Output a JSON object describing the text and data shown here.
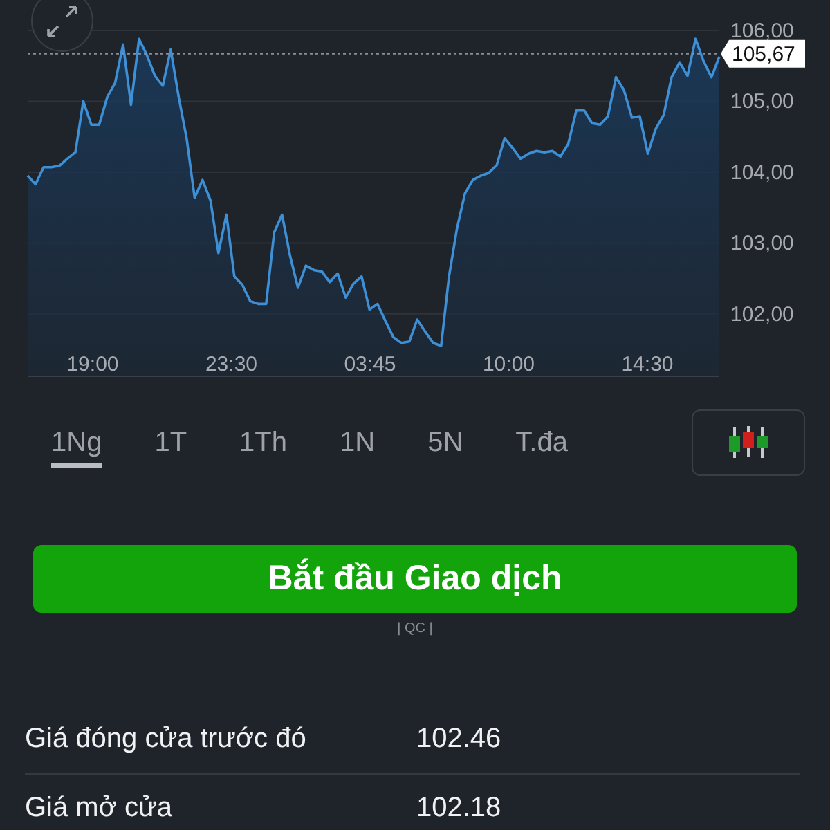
{
  "chart": {
    "time_labels": [
      "19:00",
      "23:30",
      "03:45",
      "10:00",
      "14:30"
    ],
    "chart_data": {
      "type": "area",
      "grid": true,
      "ylim": [
        101.12,
        106
      ],
      "yticks": [
        {
          "value": 102,
          "label": "102,00"
        },
        {
          "value": 103,
          "label": "103,00"
        },
        {
          "value": 104,
          "label": "104,00"
        },
        {
          "value": 105,
          "label": "105,00"
        },
        {
          "value": 106,
          "label": "106,00"
        }
      ],
      "series": [
        {
          "color": "#3d8fd6",
          "values": [
            103.95,
            103.83,
            104.07,
            104.07,
            104.09,
            104.19,
            104.28,
            105.0,
            104.67,
            104.67,
            105.06,
            105.26,
            105.8,
            104.95,
            105.88,
            105.65,
            105.36,
            105.22,
            105.73,
            105.06,
            104.48,
            103.64,
            103.89,
            103.6,
            102.86,
            103.4,
            102.53,
            102.41,
            102.18,
            102.14,
            102.14,
            103.15,
            103.4,
            102.82,
            102.37,
            102.68,
            102.62,
            102.6,
            102.45,
            102.57,
            102.23,
            102.43,
            102.53,
            102.06,
            102.14,
            101.9,
            101.67,
            101.59,
            101.61,
            101.92,
            101.75,
            101.59,
            101.55,
            102.53,
            103.2,
            103.7,
            103.89,
            103.95,
            103.99,
            104.1,
            104.48,
            104.34,
            104.19,
            104.26,
            104.3,
            104.28,
            104.3,
            104.22,
            104.4,
            104.87,
            104.87,
            104.69,
            104.67,
            104.79,
            105.34,
            105.16,
            104.77,
            104.79,
            104.26,
            104.61,
            104.81,
            105.34,
            105.55,
            105.36,
            105.88,
            105.57,
            105.34,
            105.63
          ]
        }
      ],
      "ref_lines": [
        {
          "axis": "y",
          "value": 105.67,
          "label": "105,67"
        }
      ]
    }
  },
  "ranges": [
    {
      "label": "1Ng",
      "selected": true
    },
    {
      "label": "1T",
      "selected": false
    },
    {
      "label": "1Th",
      "selected": false
    },
    {
      "label": "1N",
      "selected": false
    },
    {
      "label": "5N",
      "selected": false
    },
    {
      "label": "T.đa",
      "selected": false
    }
  ],
  "trade_button": "Bắt đầu Giao dịch",
  "ad_label": "| QC |",
  "stats": [
    {
      "label": "Giá đóng cửa trước đó",
      "value": "102.46"
    },
    {
      "label": "Giá mở cửa",
      "value": "102.18"
    }
  ]
}
